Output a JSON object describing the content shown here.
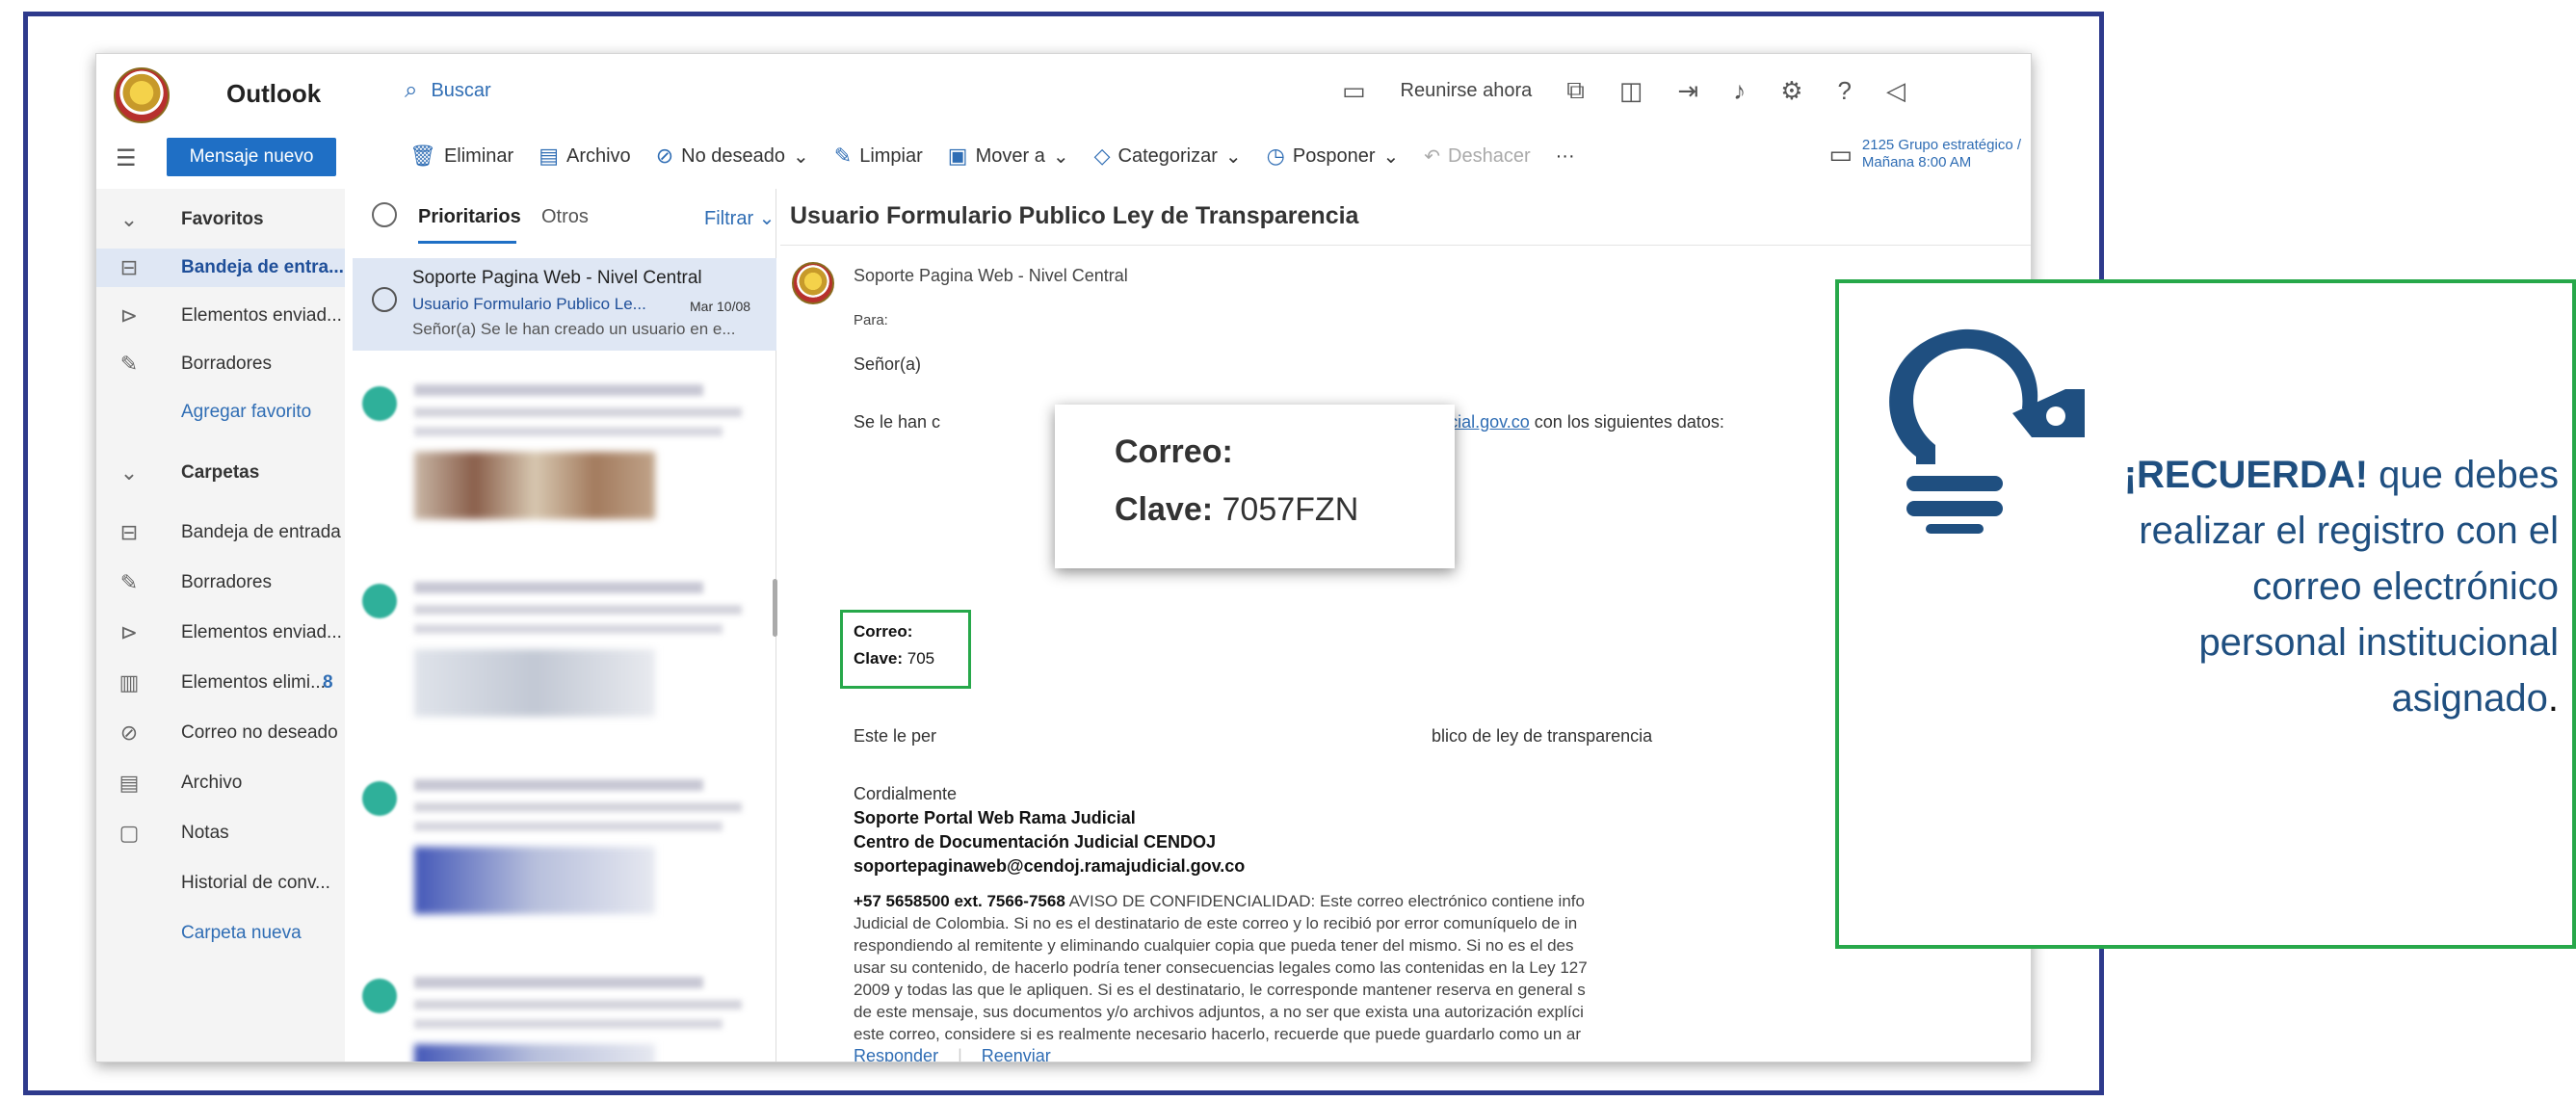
{
  "app": {
    "name": "Outlook"
  },
  "search": {
    "placeholder": "Buscar"
  },
  "top_actions": {
    "meet_now": "Reunirse ahora"
  },
  "new_message": "Mensaje nuevo",
  "ribbon": {
    "delete": "Eliminar",
    "archive": "Archivo",
    "junk": "No deseado",
    "sweep": "Limpiar",
    "move": "Mover a",
    "categorize": "Categorizar",
    "snooze": "Posponer",
    "undo": "Deshacer",
    "more": "···"
  },
  "calendar_note": {
    "line1": "2125 Grupo estratégico /",
    "line2": "Mañana 8:00 AM"
  },
  "leftnav": {
    "favorites": "Favoritos",
    "inbox_short": "Bandeja de entra...",
    "sent_short": "Elementos enviad...",
    "drafts": "Borradores",
    "add_favorite": "Agregar favorito",
    "folders": "Carpetas",
    "inbox": "Bandeja de entrada",
    "drafts2": "Borradores",
    "sent2": "Elementos enviad...",
    "deleted": "Elementos elimi...",
    "deleted_count": "8",
    "junk": "Correo no deseado",
    "archive": "Archivo",
    "notes": "Notas",
    "history": "Historial de conv...",
    "new_folder": "Carpeta nueva"
  },
  "msglist": {
    "tab_focused": "Prioritarios",
    "tab_other": "Otros",
    "filter": "Filtrar",
    "selected": {
      "from": "Soporte Pagina Web - Nivel Central",
      "subject": "Usuario Formulario Publico Le...",
      "date": "Mar 10/08",
      "preview": "Señor(a) Se le han creado un usuario en e..."
    }
  },
  "reading": {
    "title": "Usuario Formulario Publico Ley de Transparencia",
    "sender": "Soporte Pagina Web - Nivel Central",
    "to_label": "Para:",
    "greeting": "Señor(a)",
    "line1_start": "Se le han c",
    "line1_link": "idicial.gov.co",
    "line1_end": "con los siguientes datos:",
    "email_label": "Correo:",
    "password_label": "Clave:",
    "password_partial": "705",
    "line2_start": "Este le per",
    "line2_end": "blico de ley de transparencia",
    "closing": "Cordialmente",
    "sig1": "Soporte Portal Web Rama Judicial",
    "sig2": "Centro de Documentación Judicial CENDOJ",
    "sig3": "soportepaginaweb@cendoj.ramajudicial.gov.co",
    "phone": "+57 5658500 ext. 7566-7568",
    "disclaimer_l1": "AVISO DE CONFIDENCIALIDAD: Este correo electrónico contiene info",
    "disclaimer_l2": "Judicial de Colombia. Si no es el destinatario de este correo y lo recibió por error comuníquelo de in",
    "disclaimer_l3": "respondiendo al remitente y eliminando cualquier copia que pueda tener del mismo. Si no es el des",
    "disclaimer_l4": "usar su contenido, de hacerlo podría tener consecuencias legales como las contenidas en la Ley 127",
    "disclaimer_l5": "2009 y todas las que le apliquen. Si es el destinatario, le corresponde mantener reserva en general s",
    "disclaimer_l6": "de este mensaje, sus documentos y/o archivos adjuntos, a no ser que exista una autorización explíci",
    "disclaimer_l7": "este correo, considere si es realmente necesario hacerlo, recuerde que puede guardarlo como un ar",
    "reply": "Responder",
    "forward": "Reenviar"
  },
  "popup": {
    "email_label": "Correo:",
    "password_label": "Clave:",
    "password_value": "7057FZN"
  },
  "tip": {
    "strong": "¡RECUERDA!",
    "t1": " que debes",
    "t2": "realizar el registro con el",
    "t3": "correo electrónico",
    "t4": "personal institucional",
    "t5": "asignado",
    "t6": "."
  },
  "colors": {
    "frame": "#2e3a8c",
    "accent": "#1f6fc5",
    "tip_border": "#27a84a",
    "tip_text": "#1f4f80"
  }
}
